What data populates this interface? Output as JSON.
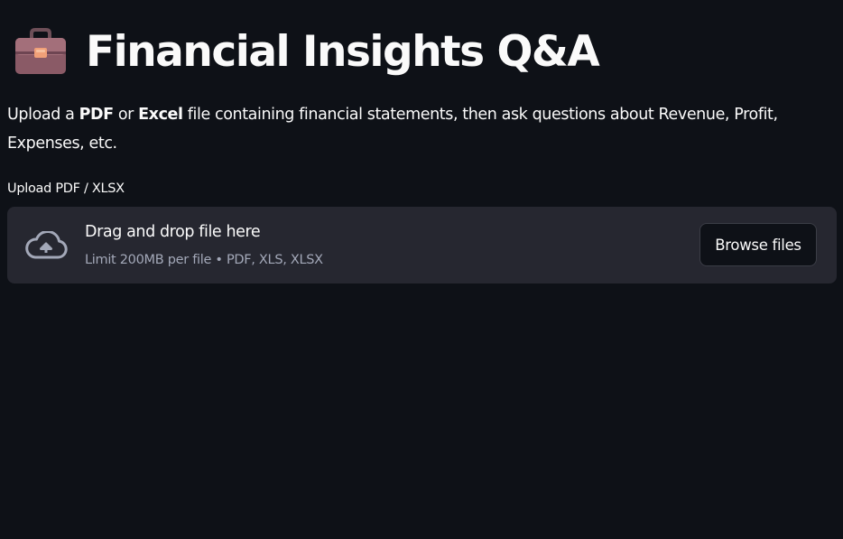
{
  "header": {
    "icon": "briefcase-icon",
    "title": "Financial Insights Q&A"
  },
  "intro": {
    "part1": "Upload a ",
    "bold1": "PDF",
    "part2": " or ",
    "bold2": "Excel",
    "part3": " file containing financial statements, then ask questions about Revenue, Profit, Expenses, etc."
  },
  "uploader": {
    "label": "Upload PDF / XLSX",
    "icon": "cloud-upload-icon",
    "drop_text": "Drag and drop file here",
    "limit_text": "Limit 200MB per file • PDF, XLS, XLSX",
    "browse_label": "Browse files"
  },
  "colors": {
    "background": "#0e1117",
    "dropzone_bg": "#262730",
    "text": "#fafafa",
    "muted_text": "#a3a8b8"
  }
}
